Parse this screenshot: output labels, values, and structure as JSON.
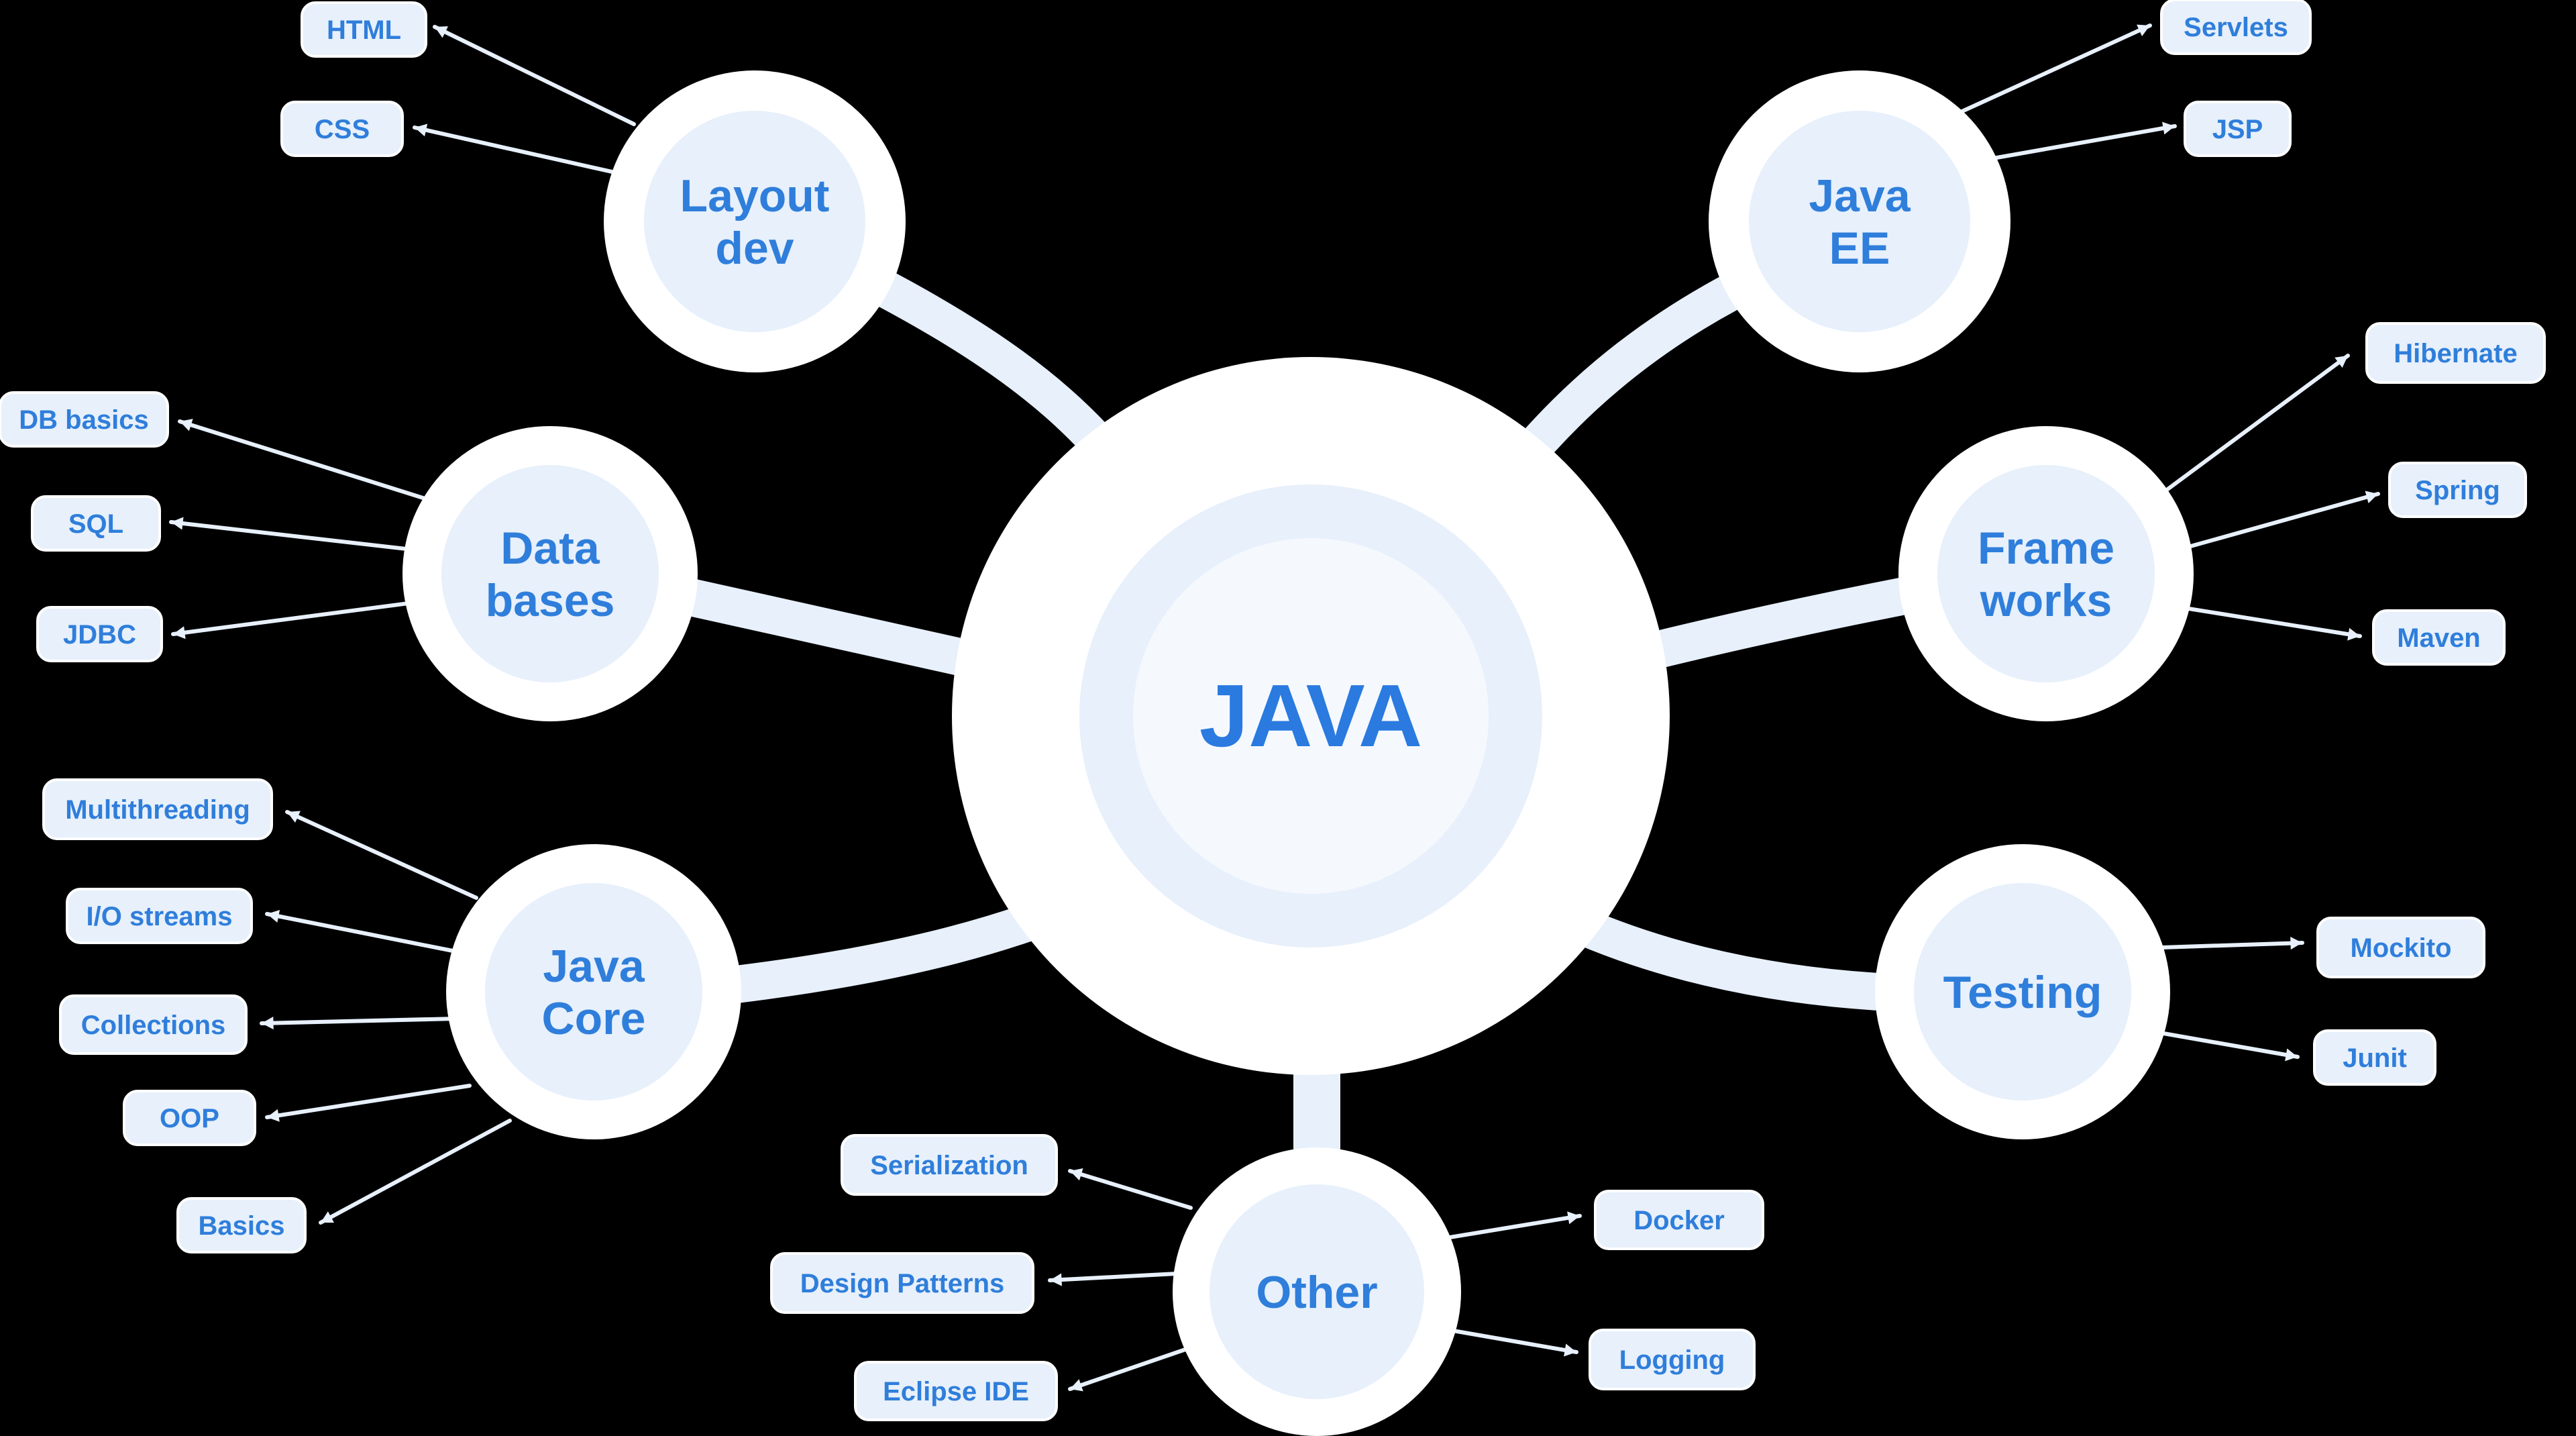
{
  "center": {
    "label": "JAVA"
  },
  "colors": {
    "background": "#000000",
    "node_fill": "#e7f0fb",
    "node_ring": "#ffffff",
    "text_blue": "#2f7edb"
  },
  "topics": [
    {
      "id": "layout",
      "label_lines": [
        "Layout",
        "dev"
      ],
      "leaves": [
        {
          "label": "HTML"
        },
        {
          "label": "CSS"
        }
      ]
    },
    {
      "id": "javaee",
      "label_lines": [
        "Java",
        "EE"
      ],
      "leaves": [
        {
          "label": "Servlets"
        },
        {
          "label": "JSP"
        }
      ]
    },
    {
      "id": "databases",
      "label_lines": [
        "Data",
        "bases"
      ],
      "leaves": [
        {
          "label": "DB basics"
        },
        {
          "label": "SQL"
        },
        {
          "label": "JDBC"
        }
      ]
    },
    {
      "id": "frameworks",
      "label_lines": [
        "Frame",
        "works"
      ],
      "leaves": [
        {
          "label": "Hibernate"
        },
        {
          "label": "Spring"
        },
        {
          "label": "Maven"
        }
      ]
    },
    {
      "id": "javacore",
      "label_lines": [
        "Java",
        "Core"
      ],
      "leaves": [
        {
          "label": "Multithreading"
        },
        {
          "label": "I/O streams"
        },
        {
          "label": "Collections"
        },
        {
          "label": "OOP"
        },
        {
          "label": "Basics"
        }
      ]
    },
    {
      "id": "testing",
      "label_lines": [
        "Testing"
      ],
      "leaves": [
        {
          "label": "Mockito"
        },
        {
          "label": "Junit"
        }
      ]
    },
    {
      "id": "other",
      "label_lines": [
        "Other"
      ],
      "leaves": [
        {
          "label": "Serialization"
        },
        {
          "label": "Design Patterns"
        },
        {
          "label": "Eclipse IDE"
        },
        {
          "label": "Docker"
        },
        {
          "label": "Logging"
        }
      ]
    }
  ]
}
